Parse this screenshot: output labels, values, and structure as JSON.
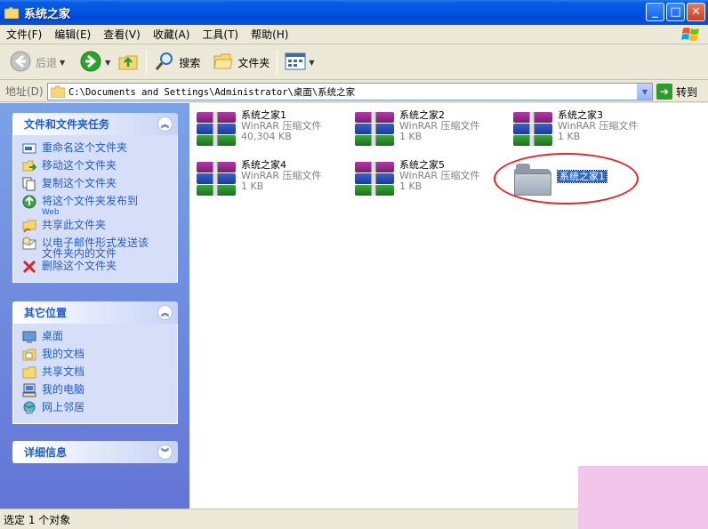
{
  "window": {
    "title": "系统之家"
  },
  "menu": [
    {
      "label": "文件(F)"
    },
    {
      "label": "编辑(E)"
    },
    {
      "label": "查看(V)"
    },
    {
      "label": "收藏(A)"
    },
    {
      "label": "工具(T)"
    },
    {
      "label": "帮助(H)"
    }
  ],
  "toolbar": {
    "back": "后退",
    "search": "搜索",
    "folders": "文件夹"
  },
  "address": {
    "label": "地址(D)",
    "path": "C:\\Documents and Settings\\Administrator\\桌面\\系统之家",
    "go": "转到"
  },
  "tasks_panel": {
    "title": "文件和文件夹任务",
    "items": [
      {
        "label": "重命名这个文件夹",
        "icon": "rename-icon"
      },
      {
        "label": "移动这个文件夹",
        "icon": "move-icon"
      },
      {
        "label": "复制这个文件夹",
        "icon": "copy-icon"
      },
      {
        "label": "将这个文件夹发布到",
        "sub": "Web",
        "icon": "web-publish-icon"
      },
      {
        "label": "共享此文件夹",
        "icon": "share-icon"
      },
      {
        "label": "以电子邮件形式发送该",
        "label2": "文件夹内的文件",
        "icon": "email-icon"
      },
      {
        "label": "删除这个文件夹",
        "icon": "delete-icon"
      }
    ]
  },
  "places_panel": {
    "title": "其它位置",
    "items": [
      {
        "label": "桌面",
        "icon": "desktop-icon"
      },
      {
        "label": "我的文档",
        "icon": "my-documents-icon"
      },
      {
        "label": "共享文档",
        "icon": "shared-documents-icon"
      },
      {
        "label": "我的电脑",
        "icon": "my-computer-icon"
      },
      {
        "label": "网上邻居",
        "icon": "network-icon"
      }
    ]
  },
  "details_panel": {
    "title": "详细信息"
  },
  "files": [
    {
      "name": "系统之家1",
      "type": "WinRAR 压缩文件",
      "size": "40,304 KB"
    },
    {
      "name": "系统之家2",
      "type": "WinRAR 压缩文件",
      "size": "1 KB"
    },
    {
      "name": "系统之家3",
      "type": "WinRAR 压缩文件",
      "size": "1 KB"
    },
    {
      "name": "系统之家4",
      "type": "WinRAR 压缩文件",
      "size": "1 KB"
    },
    {
      "name": "系统之家5",
      "type": "WinRAR 压缩文件",
      "size": "1 KB"
    }
  ],
  "selected_folder": {
    "name": "系统之家1"
  },
  "status": {
    "text": "选定 1 个对象"
  },
  "colors": {
    "title_bar": "#0054e3",
    "task_link": "#215dc6",
    "selection": "#316ac5",
    "highlight_ring": "#e0262c"
  }
}
